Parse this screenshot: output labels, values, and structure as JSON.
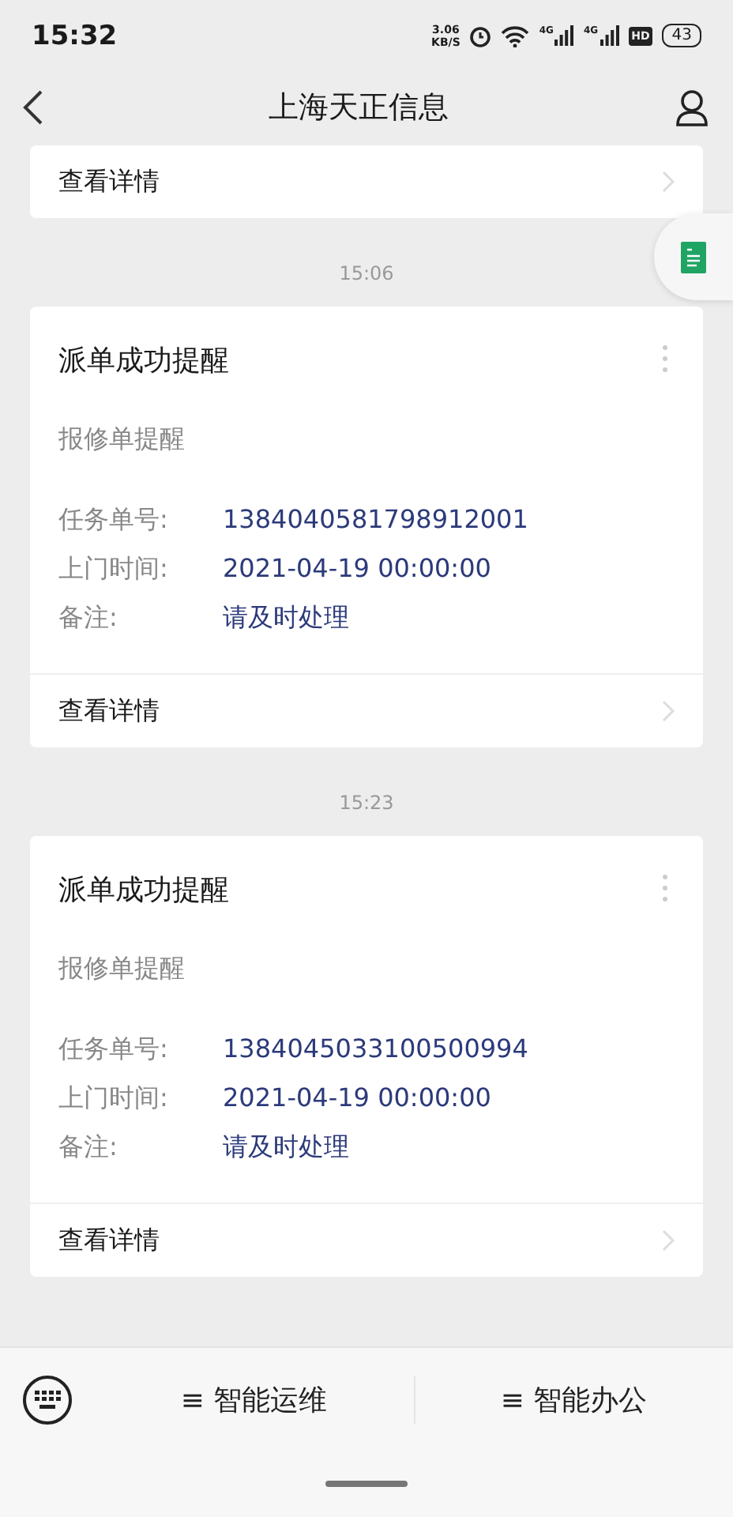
{
  "status_bar": {
    "time": "15:32",
    "speed_value": "3.06",
    "speed_unit": "KB/S",
    "network_1": "4G",
    "network_2": "4G",
    "hd": "HD",
    "battery": "43"
  },
  "nav": {
    "title": "上海天正信息"
  },
  "partial_card": {
    "link": "查看详情"
  },
  "messages": [
    {
      "time": "15:06",
      "title": "派单成功提醒",
      "subtitle": "报修单提醒",
      "fields": [
        {
          "label": "任务单号:",
          "value": "1384040581798912001"
        },
        {
          "label": "上门时间:",
          "value": "2021-04-19 00:00:00"
        },
        {
          "label": "备注:",
          "value": "请及时处理"
        }
      ],
      "link": "查看详情"
    },
    {
      "time": "15:23",
      "title": "派单成功提醒",
      "subtitle": "报修单提醒",
      "fields": [
        {
          "label": "任务单号:",
          "value": "1384045033100500994"
        },
        {
          "label": "上门时间:",
          "value": "2021-04-19 00:00:00"
        },
        {
          "label": "备注:",
          "value": "请及时处理"
        }
      ],
      "link": "查看详情"
    }
  ],
  "menu": [
    {
      "label": "≡ 智能运维"
    },
    {
      "label": "≡ 智能办公"
    }
  ]
}
